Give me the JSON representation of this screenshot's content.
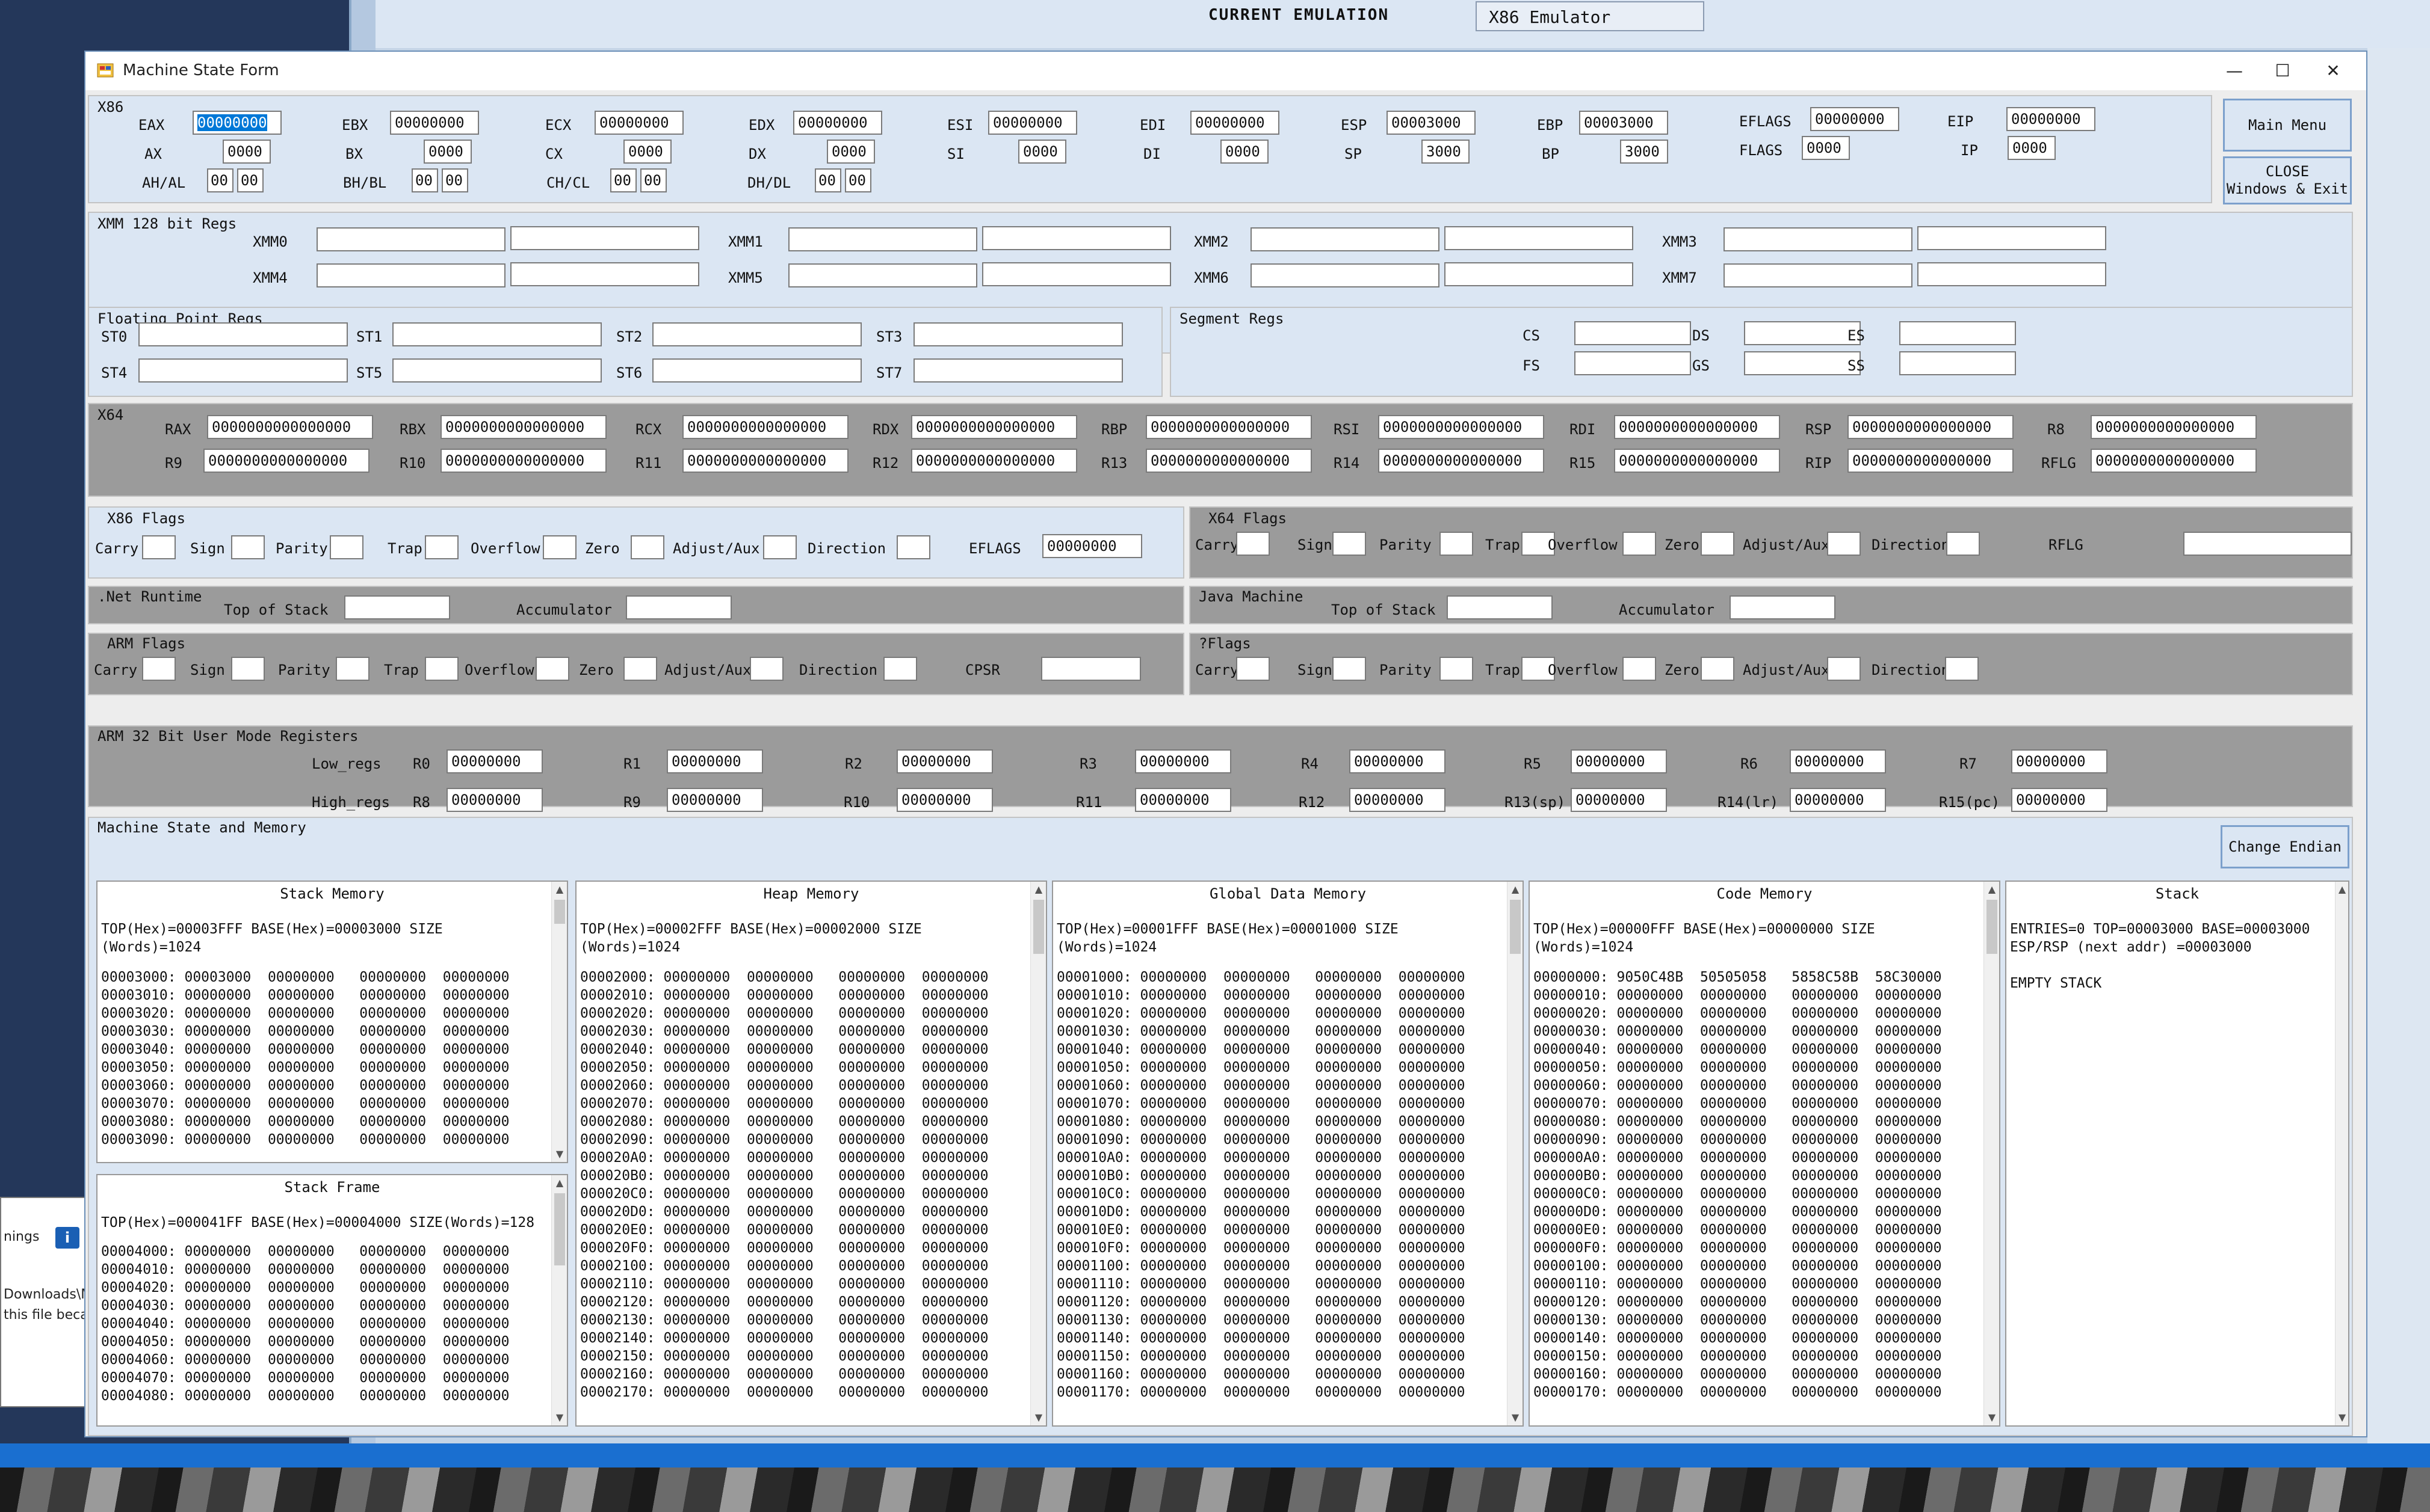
{
  "background": {
    "current_emulation_label": "CURRENT EMULATION",
    "current_emulation_value": "X86 Emulator",
    "side_window": {
      "lines": [
        "nings",
        "Downloads\\M",
        "this file beca"
      ]
    }
  },
  "window": {
    "title": "Machine State Form",
    "controls": {
      "minimize": "—",
      "maximize": "☐",
      "close": "✕"
    }
  },
  "buttons": {
    "main_menu": "Main Menu",
    "close_line1": "CLOSE",
    "close_line2": "Windows & Exit",
    "change_endian": "Change Endian"
  },
  "x86": {
    "title": "X86",
    "row1": [
      {
        "label": "EAX",
        "value": "00000000"
      },
      {
        "label": "EBX",
        "value": "00000000"
      },
      {
        "label": "ECX",
        "value": "00000000"
      },
      {
        "label": "EDX",
        "value": "00000000"
      },
      {
        "label": "ESI",
        "value": "00000000"
      },
      {
        "label": "EDI",
        "value": "00000000"
      },
      {
        "label": "ESP",
        "value": "00003000"
      },
      {
        "label": "EBP",
        "value": "00003000"
      },
      {
        "label": "EFLAGS",
        "value": "00000000"
      },
      {
        "label": "EIP",
        "value": "00000000"
      }
    ],
    "row2": [
      {
        "label": "AX",
        "value": "0000"
      },
      {
        "label": "BX",
        "value": "0000"
      },
      {
        "label": "CX",
        "value": "0000"
      },
      {
        "label": "DX",
        "value": "0000"
      },
      {
        "label": "SI",
        "value": "0000"
      },
      {
        "label": "DI",
        "value": "0000"
      },
      {
        "label": "SP",
        "value": "3000"
      },
      {
        "label": "BP",
        "value": "3000"
      },
      {
        "label": "FLAGS",
        "value": "0000"
      },
      {
        "label": "IP",
        "value": "0000"
      }
    ],
    "row3": [
      {
        "label": "AH/AL",
        "hi": "00",
        "lo": "00"
      },
      {
        "label": "BH/BL",
        "hi": "00",
        "lo": "00"
      },
      {
        "label": "CH/CL",
        "hi": "00",
        "lo": "00"
      },
      {
        "label": "DH/DL",
        "hi": "00",
        "lo": "00"
      }
    ]
  },
  "xmm": {
    "title": "XMM 128 bit Regs",
    "regs": [
      {
        "label": "XMM0",
        "a": "",
        "b": ""
      },
      {
        "label": "XMM1",
        "a": "",
        "b": ""
      },
      {
        "label": "XMM2",
        "a": "",
        "b": ""
      },
      {
        "label": "XMM3",
        "a": "",
        "b": ""
      },
      {
        "label": "XMM4",
        "a": "",
        "b": ""
      },
      {
        "label": "XMM5",
        "a": "",
        "b": ""
      },
      {
        "label": "XMM6",
        "a": "",
        "b": ""
      },
      {
        "label": "XMM7",
        "a": "",
        "b": ""
      }
    ]
  },
  "fp": {
    "title": "Floating Point Regs",
    "regs": [
      {
        "label": "ST0",
        "value": ""
      },
      {
        "label": "ST1",
        "value": ""
      },
      {
        "label": "ST2",
        "value": ""
      },
      {
        "label": "ST3",
        "value": ""
      },
      {
        "label": "ST4",
        "value": ""
      },
      {
        "label": "ST5",
        "value": ""
      },
      {
        "label": "ST6",
        "value": ""
      },
      {
        "label": "ST7",
        "value": ""
      }
    ]
  },
  "seg": {
    "title": "Segment Regs",
    "regs": [
      {
        "label": "CS",
        "value": ""
      },
      {
        "label": "DS",
        "value": ""
      },
      {
        "label": "ES",
        "value": ""
      },
      {
        "label": "FS",
        "value": ""
      },
      {
        "label": "GS",
        "value": ""
      },
      {
        "label": "SS",
        "value": ""
      }
    ]
  },
  "x64": {
    "title": "X64",
    "regs": [
      {
        "label": "RAX",
        "value": "0000000000000000"
      },
      {
        "label": "RBX",
        "value": "0000000000000000"
      },
      {
        "label": "RCX",
        "value": "0000000000000000"
      },
      {
        "label": "RDX",
        "value": "0000000000000000"
      },
      {
        "label": "RBP",
        "value": "0000000000000000"
      },
      {
        "label": "RSI",
        "value": "0000000000000000"
      },
      {
        "label": "RDI",
        "value": "0000000000000000"
      },
      {
        "label": "RSP",
        "value": "0000000000000000"
      },
      {
        "label": "R8",
        "value": "0000000000000000"
      },
      {
        "label": "R9",
        "value": "0000000000000000"
      },
      {
        "label": "R10",
        "value": "0000000000000000"
      },
      {
        "label": "R11",
        "value": "0000000000000000"
      },
      {
        "label": "R12",
        "value": "0000000000000000"
      },
      {
        "label": "R13",
        "value": "0000000000000000"
      },
      {
        "label": "R14",
        "value": "0000000000000000"
      },
      {
        "label": "R15",
        "value": "0000000000000000"
      },
      {
        "label": "RIP",
        "value": "0000000000000000"
      },
      {
        "label": "RFLG",
        "value": "0000000000000000"
      }
    ]
  },
  "x86flags": {
    "title": "X86 Flags",
    "flags": [
      "Carry",
      "Sign",
      "Parity",
      "Trap",
      "Overflow",
      "Zero",
      "Adjust/Aux",
      "Direction"
    ],
    "eflags_label": "EFLAGS",
    "eflags_value": "00000000"
  },
  "x64flags": {
    "title": "X64 Flags",
    "flags": [
      "Carry",
      "Sign",
      "Parity",
      "Trap",
      "Overflow",
      "Zero",
      "Adjust/Aux",
      "Direction"
    ],
    "rflg_label": "RFLG",
    "rflg_value": ""
  },
  "dotnet": {
    "title": ".Net Runtime",
    "top_label": "Top of Stack",
    "top_value": "",
    "acc_label": "Accumulator",
    "acc_value": ""
  },
  "java": {
    "title": "Java Machine",
    "top_label": "Top of Stack",
    "top_value": "",
    "acc_label": "Accumulator",
    "acc_value": ""
  },
  "armflags": {
    "title": "ARM Flags",
    "flags": [
      "Carry",
      "Sign",
      "Parity",
      "Trap",
      "Overflow",
      "Zero",
      "Adjust/Aux",
      "Direction"
    ],
    "cpsr_label": "CPSR",
    "cpsr_value": ""
  },
  "qflags": {
    "title": "?Flags",
    "flags": [
      "Carry",
      "Sign",
      "Parity",
      "Trap",
      "Overflow",
      "Zero",
      "Adjust/Aux",
      "Direction"
    ]
  },
  "arm32": {
    "title": "ARM 32 Bit User Mode Registers",
    "low_label": "Low_regs",
    "high_label": "High_regs",
    "low": [
      {
        "label": "R0",
        "value": "00000000"
      },
      {
        "label": "R1",
        "value": "00000000"
      },
      {
        "label": "R2",
        "value": "00000000"
      },
      {
        "label": "R3",
        "value": "00000000"
      },
      {
        "label": "R4",
        "value": "00000000"
      },
      {
        "label": "R5",
        "value": "00000000"
      },
      {
        "label": "R6",
        "value": "00000000"
      },
      {
        "label": "R7",
        "value": "00000000"
      }
    ],
    "high": [
      {
        "label": "R8",
        "value": "00000000"
      },
      {
        "label": "R9",
        "value": "00000000"
      },
      {
        "label": "R10",
        "value": "00000000"
      },
      {
        "label": "R11",
        "value": "00000000"
      },
      {
        "label": "R12",
        "value": "00000000"
      },
      {
        "label": "R13(sp)",
        "value": "00000000"
      },
      {
        "label": "R14(lr)",
        "value": "00000000"
      },
      {
        "label": "R15(pc)",
        "value": "00000000"
      }
    ]
  },
  "memory": {
    "title": "Machine State and Memory",
    "stack_memory": {
      "title": "Stack Memory",
      "header": "TOP(Hex)=00003FFF BASE(Hex)=00003000 SIZE\n(Words)=1024",
      "rows": [
        "00003000: 00003000  00000000   00000000  00000000",
        "00003010: 00000000  00000000   00000000  00000000",
        "00003020: 00000000  00000000   00000000  00000000",
        "00003030: 00000000  00000000   00000000  00000000",
        "00003040: 00000000  00000000   00000000  00000000",
        "00003050: 00000000  00000000   00000000  00000000",
        "00003060: 00000000  00000000   00000000  00000000",
        "00003070: 00000000  00000000   00000000  00000000",
        "00003080: 00000000  00000000   00000000  00000000",
        "00003090: 00000000  00000000   00000000  00000000"
      ]
    },
    "stack_frame": {
      "title": "Stack Frame",
      "header": "TOP(Hex)=000041FF BASE(Hex)=00004000 SIZE(Words)=128",
      "rows": [
        "00004000: 00000000  00000000   00000000  00000000",
        "00004010: 00000000  00000000   00000000  00000000",
        "00004020: 00000000  00000000   00000000  00000000",
        "00004030: 00000000  00000000   00000000  00000000",
        "00004040: 00000000  00000000   00000000  00000000",
        "00004050: 00000000  00000000   00000000  00000000",
        "00004060: 00000000  00000000   00000000  00000000",
        "00004070: 00000000  00000000   00000000  00000000",
        "00004080: 00000000  00000000   00000000  00000000"
      ]
    },
    "heap_memory": {
      "title": "Heap Memory",
      "header": "TOP(Hex)=00002FFF BASE(Hex)=00002000 SIZE\n(Words)=1024",
      "rows": [
        "00002000: 00000000  00000000   00000000  00000000",
        "00002010: 00000000  00000000   00000000  00000000",
        "00002020: 00000000  00000000   00000000  00000000",
        "00002030: 00000000  00000000   00000000  00000000",
        "00002040: 00000000  00000000   00000000  00000000",
        "00002050: 00000000  00000000   00000000  00000000",
        "00002060: 00000000  00000000   00000000  00000000",
        "00002070: 00000000  00000000   00000000  00000000",
        "00002080: 00000000  00000000   00000000  00000000",
        "00002090: 00000000  00000000   00000000  00000000",
        "000020A0: 00000000  00000000   00000000  00000000",
        "000020B0: 00000000  00000000   00000000  00000000",
        "000020C0: 00000000  00000000   00000000  00000000",
        "000020D0: 00000000  00000000   00000000  00000000",
        "000020E0: 00000000  00000000   00000000  00000000",
        "000020F0: 00000000  00000000   00000000  00000000",
        "00002100: 00000000  00000000   00000000  00000000",
        "00002110: 00000000  00000000   00000000  00000000",
        "00002120: 00000000  00000000   00000000  00000000",
        "00002130: 00000000  00000000   00000000  00000000",
        "00002140: 00000000  00000000   00000000  00000000",
        "00002150: 00000000  00000000   00000000  00000000",
        "00002160: 00000000  00000000   00000000  00000000",
        "00002170: 00000000  00000000   00000000  00000000"
      ]
    },
    "global_memory": {
      "title": "Global Data Memory",
      "header": "TOP(Hex)=00001FFF BASE(Hex)=00001000 SIZE\n(Words)=1024",
      "rows": [
        "00001000: 00000000  00000000   00000000  00000000",
        "00001010: 00000000  00000000   00000000  00000000",
        "00001020: 00000000  00000000   00000000  00000000",
        "00001030: 00000000  00000000   00000000  00000000",
        "00001040: 00000000  00000000   00000000  00000000",
        "00001050: 00000000  00000000   00000000  00000000",
        "00001060: 00000000  00000000   00000000  00000000",
        "00001070: 00000000  00000000   00000000  00000000",
        "00001080: 00000000  00000000   00000000  00000000",
        "00001090: 00000000  00000000   00000000  00000000",
        "000010A0: 00000000  00000000   00000000  00000000",
        "000010B0: 00000000  00000000   00000000  00000000",
        "000010C0: 00000000  00000000   00000000  00000000",
        "000010D0: 00000000  00000000   00000000  00000000",
        "000010E0: 00000000  00000000   00000000  00000000",
        "000010F0: 00000000  00000000   00000000  00000000",
        "00001100: 00000000  00000000   00000000  00000000",
        "00001110: 00000000  00000000   00000000  00000000",
        "00001120: 00000000  00000000   00000000  00000000",
        "00001130: 00000000  00000000   00000000  00000000",
        "00001140: 00000000  00000000   00000000  00000000",
        "00001150: 00000000  00000000   00000000  00000000",
        "00001160: 00000000  00000000   00000000  00000000",
        "00001170: 00000000  00000000   00000000  00000000"
      ]
    },
    "code_memory": {
      "title": "Code Memory",
      "header": "TOP(Hex)=00000FFF BASE(Hex)=00000000 SIZE\n(Words)=1024",
      "rows": [
        "00000000: 9050C48B  50505058   5858C58B  58C30000",
        "00000010: 00000000  00000000   00000000  00000000",
        "00000020: 00000000  00000000   00000000  00000000",
        "00000030: 00000000  00000000   00000000  00000000",
        "00000040: 00000000  00000000   00000000  00000000",
        "00000050: 00000000  00000000   00000000  00000000",
        "00000060: 00000000  00000000   00000000  00000000",
        "00000070: 00000000  00000000   00000000  00000000",
        "00000080: 00000000  00000000   00000000  00000000",
        "00000090: 00000000  00000000   00000000  00000000",
        "000000A0: 00000000  00000000   00000000  00000000",
        "000000B0: 00000000  00000000   00000000  00000000",
        "000000C0: 00000000  00000000   00000000  00000000",
        "000000D0: 00000000  00000000   00000000  00000000",
        "000000E0: 00000000  00000000   00000000  00000000",
        "000000F0: 00000000  00000000   00000000  00000000",
        "00000100: 00000000  00000000   00000000  00000000",
        "00000110: 00000000  00000000   00000000  00000000",
        "00000120: 00000000  00000000   00000000  00000000",
        "00000130: 00000000  00000000   00000000  00000000",
        "00000140: 00000000  00000000   00000000  00000000",
        "00000150: 00000000  00000000   00000000  00000000",
        "00000160: 00000000  00000000   00000000  00000000",
        "00000170: 00000000  00000000   00000000  00000000"
      ]
    },
    "stack": {
      "title": "Stack",
      "header": "ENTRIES=0 TOP=00003000 BASE=00003000\nESP/RSP (next addr) =00003000\n\nEMPTY STACK"
    }
  },
  "colors": {
    "panel_blue": "#dbe6f3",
    "panel_gray": "#9b9b9b",
    "selection": "#0078d7",
    "accent_border": "#7ca0cc"
  }
}
